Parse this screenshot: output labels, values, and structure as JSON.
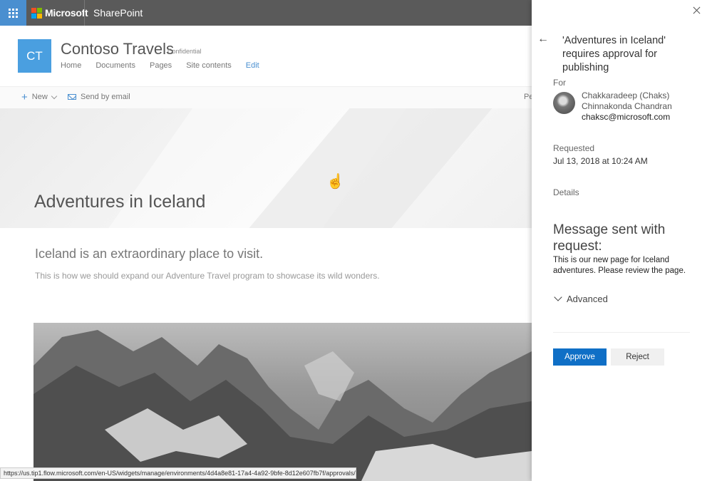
{
  "suitebar": {
    "brand": "Microsoft",
    "app_name": "SharePoint",
    "logo_colors": [
      "#f25022",
      "#7fba00",
      "#00a4ef",
      "#ffb900"
    ]
  },
  "site": {
    "logo_initials": "CT",
    "title": "Contoso Travels",
    "classification": "Confidential",
    "nav": [
      "Home",
      "Documents",
      "Pages",
      "Site contents",
      "Edit"
    ]
  },
  "commandbar": {
    "new_label": "New",
    "email_label": "Send by email",
    "truncated_label": "Pe"
  },
  "page": {
    "title": "Adventures in Iceland",
    "lead": "Iceland is an extraordinary place to visit.",
    "body": "This is how we should expand our Adventure Travel program to showcase its wild wonders."
  },
  "status_url": "https://us.tip1.flow.microsoft.com/en-US/widgets/manage/environments/4d4a8e81-17a4-4a92-9bfe-8d12e607fb7f/approvals/",
  "approval": {
    "title": "'Adventures in Iceland' requires approval for publishing",
    "for_label": "For",
    "requester_name": "Chakkaradeep (Chaks) Chinnakonda Chandran",
    "requester_email": "chaksc@microsoft.com",
    "requested_label": "Requested",
    "requested_value": "Jul 13, 2018 at 10:24 AM",
    "details_label": "Details",
    "message_heading": "Message sent with request:",
    "message_body": "This is our new page for Iceland adventures. Please review the page.",
    "advanced_label": "Advanced",
    "approve_label": "Approve",
    "reject_label": "Reject"
  },
  "icons": [
    "app-launcher-icon",
    "microsoft-logo-icon",
    "plus-icon",
    "mail-icon",
    "close-icon",
    "back-arrow-icon",
    "chevron-down-icon",
    "hand-cursor-icon"
  ],
  "colors": {
    "suitebar": "#5a5a5a",
    "waffle": "#4a8fd0",
    "site_logo": "#4a9fe0",
    "approve_button": "#0f6fc6",
    "link_accent": "#4a8fd0"
  }
}
